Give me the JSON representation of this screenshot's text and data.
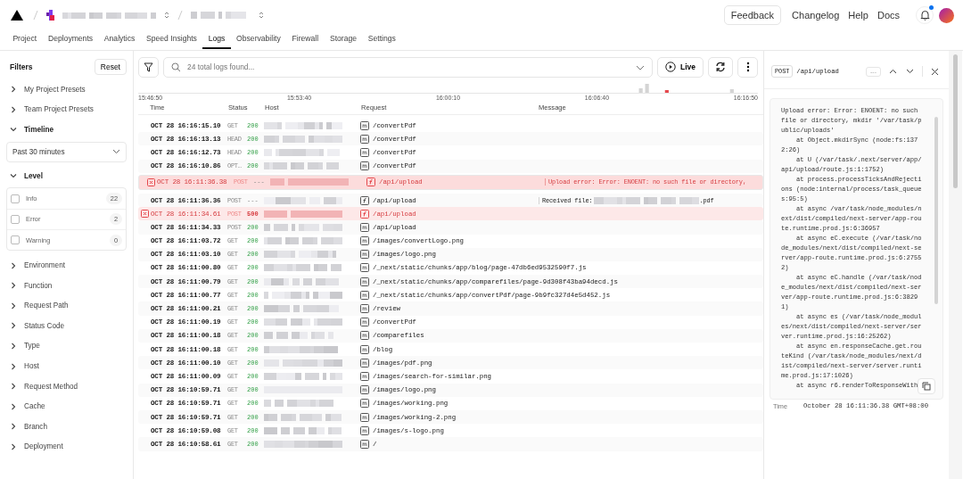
{
  "header": {
    "feedback": "Feedback",
    "links": [
      "Changelog",
      "Help",
      "Docs"
    ],
    "notifications": {
      "unread": true
    }
  },
  "tabs": [
    {
      "label": "Project",
      "selected": false
    },
    {
      "label": "Deployments",
      "selected": false
    },
    {
      "label": "Analytics",
      "selected": false
    },
    {
      "label": "Speed Insights",
      "selected": false
    },
    {
      "label": "Logs",
      "selected": true
    },
    {
      "label": "Observability",
      "selected": false
    },
    {
      "label": "Firewall",
      "selected": false
    },
    {
      "label": "Storage",
      "selected": false
    },
    {
      "label": "Settings",
      "selected": false
    }
  ],
  "filters": {
    "title": "Filters",
    "reset": "Reset",
    "sections": [
      {
        "label": "My Project Presets",
        "expanded": false
      },
      {
        "label": "Team Project Presets",
        "expanded": false
      },
      {
        "label": "Timeline",
        "expanded": true,
        "kind": "select",
        "value": "Past 30 minutes"
      },
      {
        "label": "Level",
        "expanded": true,
        "kind": "levels",
        "options": [
          {
            "label": "Info",
            "count": "22",
            "checked": false
          },
          {
            "label": "Error",
            "count": "2",
            "checked": false
          },
          {
            "label": "Warning",
            "count": "0",
            "checked": false
          }
        ]
      },
      {
        "label": "Environment",
        "expanded": false
      },
      {
        "label": "Function",
        "expanded": false
      },
      {
        "label": "Request Path",
        "expanded": false
      },
      {
        "label": "Status Code",
        "expanded": false
      },
      {
        "label": "Type",
        "expanded": false
      },
      {
        "label": "Host",
        "expanded": false
      },
      {
        "label": "Request Method",
        "expanded": false
      },
      {
        "label": "Cache",
        "expanded": false
      },
      {
        "label": "Branch",
        "expanded": false
      },
      {
        "label": "Deployment",
        "expanded": false
      }
    ]
  },
  "toolbar": {
    "search_placeholder": "24 total logs found...",
    "live": "Live"
  },
  "timeline_ticks": [
    "15:46:50",
    "15:53:40",
    "16:00:10",
    "16:06:40",
    "16:16:50"
  ],
  "table": {
    "columns": [
      "Time",
      "Status",
      "Host",
      "Request",
      "Message"
    ],
    "rows": [
      {
        "time": "OCT 28 16:16:15.10",
        "method": "GET",
        "status": "200",
        "request": "/convertPdf",
        "kind": "page",
        "error": false,
        "selected": false
      },
      {
        "time": "OCT 28 16:16:13.13",
        "method": "HEAD",
        "status": "200",
        "request": "/convertPdf",
        "kind": "page",
        "error": false,
        "selected": false
      },
      {
        "time": "OCT 28 16:16:12.73",
        "method": "HEAD",
        "status": "200",
        "request": "/convertPdf",
        "kind": "page",
        "error": false,
        "selected": false
      },
      {
        "time": "OCT 28 16:16:10.86",
        "method": "OPT…",
        "status": "200",
        "request": "/convertPdf",
        "kind": "page",
        "error": false,
        "selected": false
      },
      {
        "time": "OCT 28 16:11:36.38",
        "method": "POST",
        "status": "---",
        "request": "/api/upload",
        "kind": "function",
        "error": true,
        "selected": true,
        "message": "Upload error: Error: ENOENT: no such file or directory,"
      },
      {
        "time": "OCT 28 16:11:36.36",
        "method": "POST",
        "status": "---",
        "request": "/api/upload",
        "kind": "function",
        "error": false,
        "selected": false,
        "message": "Received file:",
        "message_suffix": ".pdf"
      },
      {
        "time": "OCT 28 16:11:34.61",
        "method": "POST",
        "status": "500",
        "request": "/api/upload",
        "kind": "function",
        "error": true,
        "selected": false
      },
      {
        "time": "OCT 28 16:11:34.33",
        "method": "POST",
        "status": "200",
        "request": "/api/upload",
        "kind": "page",
        "error": false,
        "selected": false
      },
      {
        "time": "OCT 28 16:11:03.72",
        "method": "GET",
        "status": "200",
        "request": "/images/convertLogo.png",
        "kind": "page",
        "error": false,
        "selected": false
      },
      {
        "time": "OCT 28 16:11:03.10",
        "method": "GET",
        "status": "200",
        "request": "/images/logo.png",
        "kind": "page",
        "error": false,
        "selected": false
      },
      {
        "time": "OCT 28 16:11:00.80",
        "method": "GET",
        "status": "200",
        "request": "/_next/static/chunks/app/blog/page-47db6ed9532590f7.js",
        "kind": "page",
        "error": false,
        "selected": false
      },
      {
        "time": "OCT 28 16:11:00.79",
        "method": "GET",
        "status": "200",
        "request": "/_next/static/chunks/app/comparefiles/page-9d308f43ba94decd.js",
        "kind": "page",
        "error": false,
        "selected": false
      },
      {
        "time": "OCT 28 16:11:00.77",
        "method": "GET",
        "status": "200",
        "request": "/_next/static/chunks/app/convertPdf/page-9b9fc327d4e5d452.js",
        "kind": "page",
        "error": false,
        "selected": false
      },
      {
        "time": "OCT 28 16:11:00.21",
        "method": "GET",
        "status": "200",
        "request": "/review",
        "kind": "page",
        "error": false,
        "selected": false
      },
      {
        "time": "OCT 28 16:11:00.19",
        "method": "GET",
        "status": "200",
        "request": "/convertPdf",
        "kind": "page",
        "error": false,
        "selected": false
      },
      {
        "time": "OCT 28 16:11:00.18",
        "method": "GET",
        "status": "200",
        "request": "/comparefiles",
        "kind": "page",
        "error": false,
        "selected": false
      },
      {
        "time": "OCT 28 16:11:00.18",
        "method": "GET",
        "status": "200",
        "request": "/blog",
        "kind": "page",
        "error": false,
        "selected": false
      },
      {
        "time": "OCT 28 16:11:00.10",
        "method": "GET",
        "status": "200",
        "request": "/images/pdf.png",
        "kind": "page",
        "error": false,
        "selected": false
      },
      {
        "time": "OCT 28 16:11:00.09",
        "method": "GET",
        "status": "200",
        "request": "/images/search-for-similar.png",
        "kind": "page",
        "error": false,
        "selected": false
      },
      {
        "time": "OCT 28 16:10:59.71",
        "method": "GET",
        "status": "200",
        "request": "/images/logo.png",
        "kind": "page",
        "error": false,
        "selected": false
      },
      {
        "time": "OCT 28 16:10:59.71",
        "method": "GET",
        "status": "200",
        "request": "/images/working.png",
        "kind": "page",
        "error": false,
        "selected": false
      },
      {
        "time": "OCT 28 16:10:59.71",
        "method": "GET",
        "status": "200",
        "request": "/images/working-2.png",
        "kind": "page",
        "error": false,
        "selected": false
      },
      {
        "time": "OCT 28 16:10:59.08",
        "method": "GET",
        "status": "200",
        "request": "/images/s-logo.png",
        "kind": "page",
        "error": false,
        "selected": false
      },
      {
        "time": "OCT 28 16:10:58.61",
        "method": "GET",
        "status": "200",
        "request": "/",
        "kind": "page",
        "error": false,
        "selected": false
      }
    ]
  },
  "detail": {
    "method": "POST",
    "path": "/api/upload",
    "status": "---",
    "log": "Upload error: Error: ENOENT: no such file or directory, mkdir '/var/task/public/uploads'\n    at Object.mkdirSync (node:fs:1372:26)\n    at U (/var/task/.next/server/app/api/upload/route.js:1:1752)\n    at process.processTicksAndRejections (node:internal/process/task_queues:95:5)\n    at async /var/task/node_modules/next/dist/compiled/next-server/app-route.runtime.prod.js:6:36957\n    at async eC.execute (/var/task/node_modules/next/dist/compiled/next-server/app-route.runtime.prod.js:6:27552)\n    at async eC.handle (/var/task/node_modules/next/dist/compiled/next-server/app-route.runtime.prod.js:6:38291)\n    at async es (/var/task/node_modules/next/dist/compiled/next-server/server.runtime.prod.js:16:25262)\n    at async en.responseCache.get.routeKind (/var/task/node_modules/next/dist/compiled/next-server/server.runtime.prod.js:17:1026)\n    at async r6.renderToResponseWith",
    "time_label": "Time",
    "time": "October 28 16:11:36.38 GMT+08:00"
  }
}
